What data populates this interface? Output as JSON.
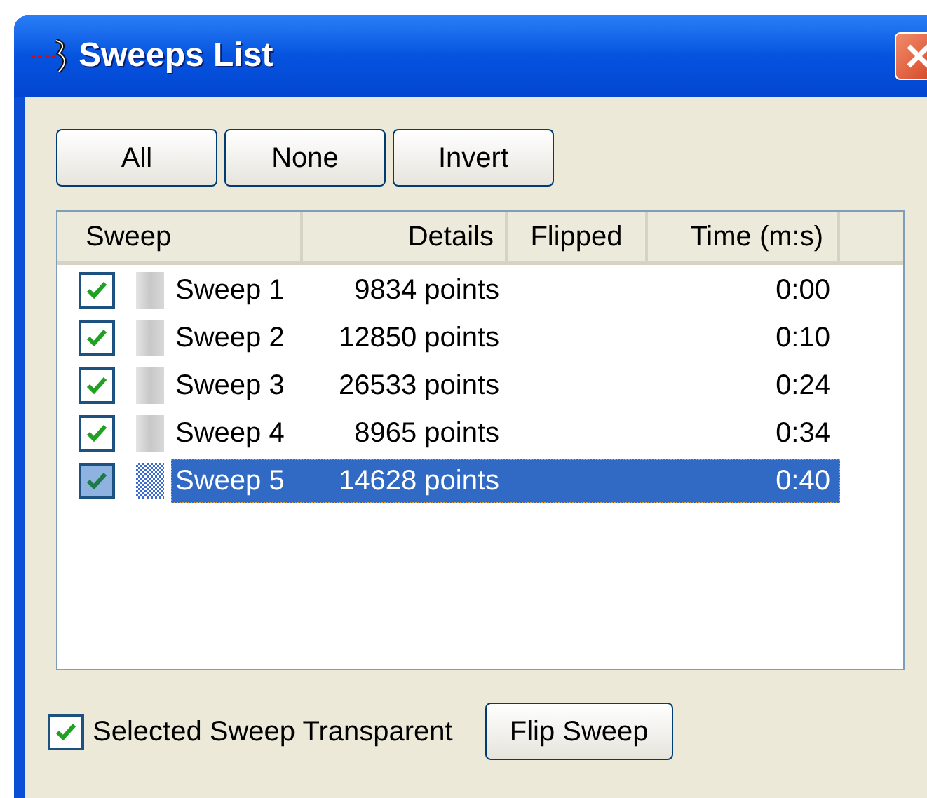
{
  "window": {
    "title": "Sweeps List"
  },
  "buttons": [
    "All",
    "None",
    "Invert"
  ],
  "table": {
    "columns": [
      "Sweep",
      "Details",
      "Flipped",
      "Time (m:s)"
    ],
    "rows": [
      {
        "name": "Sweep 1",
        "details": "9834 points",
        "time": "0:00",
        "checked": true,
        "selected": false
      },
      {
        "name": "Sweep 2",
        "details": "12850 points",
        "time": "0:10",
        "checked": true,
        "selected": false
      },
      {
        "name": "Sweep 3",
        "details": "26533 points",
        "time": "0:24",
        "checked": true,
        "selected": false
      },
      {
        "name": "Sweep 4",
        "details": "8965 points",
        "time": "0:34",
        "checked": true,
        "selected": false
      },
      {
        "name": "Sweep 5",
        "details": "14628 points",
        "time": "0:40",
        "checked": true,
        "selected": true
      }
    ]
  },
  "transparent_option": {
    "label": "Selected Sweep Transparent",
    "checked": true
  },
  "flip_button": "Flip Sweep"
}
